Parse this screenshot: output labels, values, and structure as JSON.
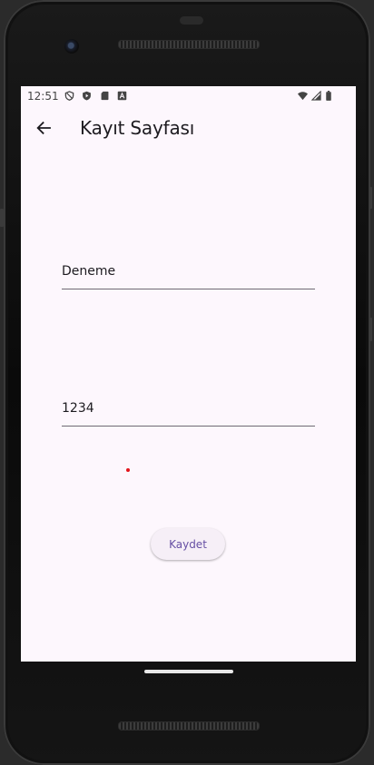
{
  "status_bar": {
    "time": "12:51",
    "left_icons": [
      "shield-icon",
      "play-protect-icon",
      "sd-card-icon",
      "text-a-icon"
    ],
    "right_icons": [
      "wifi-icon",
      "cellular-icon",
      "battery-icon"
    ]
  },
  "appbar": {
    "title": "Kayıt Sayfası",
    "back_icon": "arrow-back-icon"
  },
  "form": {
    "name_value": "Deneme",
    "password_value": "1234",
    "save_label": "Kaydet"
  },
  "colors": {
    "accent": "#6750a4",
    "background": "#fdf7fd",
    "indicator_dot": "#e3141c"
  }
}
